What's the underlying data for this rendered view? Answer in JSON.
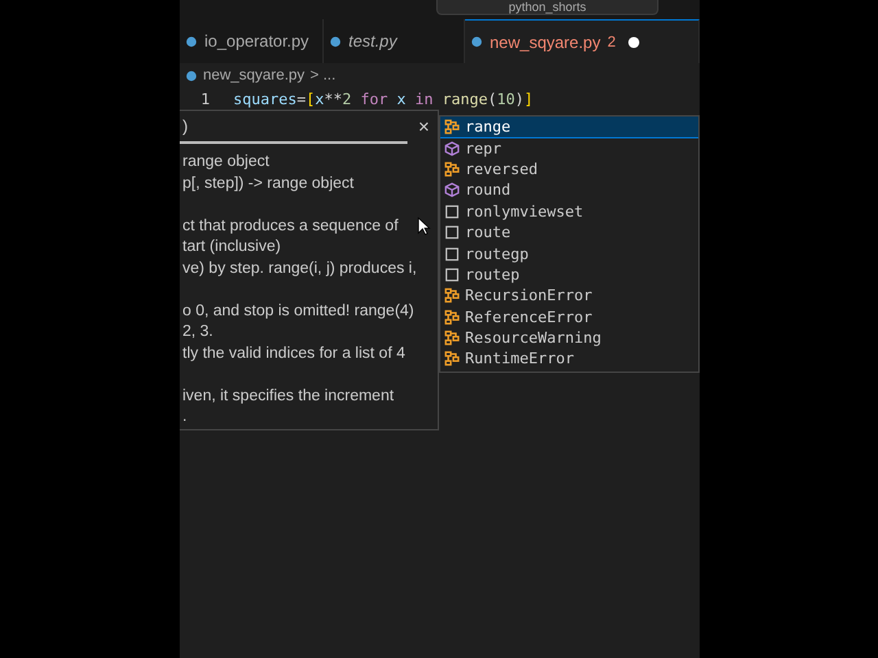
{
  "search": {
    "text": "python_shorts"
  },
  "tabs": [
    {
      "label": "io_operator.py",
      "italic": false,
      "selected": false,
      "dirty": false
    },
    {
      "label": "test.py",
      "italic": true,
      "selected": false,
      "dirty": false
    },
    {
      "label": "new_sqyare.py",
      "italic": false,
      "selected": true,
      "dirty": true,
      "problems": "2"
    }
  ],
  "breadcrumb": {
    "file": "new_sqyare.py",
    "rest": "> ..."
  },
  "editor": {
    "line_number": "1",
    "tokens": [
      {
        "text": "squares",
        "kind": "var"
      },
      {
        "text": "=",
        "kind": "op"
      },
      {
        "text": "[",
        "kind": "bracket"
      },
      {
        "text": "x",
        "kind": "var"
      },
      {
        "text": "**",
        "kind": "op"
      },
      {
        "text": "2",
        "kind": "num"
      },
      {
        "text": " for ",
        "kind": "kw"
      },
      {
        "text": "x",
        "kind": "var"
      },
      {
        "text": " in ",
        "kind": "kw"
      },
      {
        "text": "range",
        "kind": "fn"
      },
      {
        "text": "(",
        "kind": "op"
      },
      {
        "text": "10",
        "kind": "num"
      },
      {
        "text": ")",
        "kind": "op"
      },
      {
        "text": "]",
        "kind": "bracket"
      }
    ]
  },
  "hover": {
    "signature": ")",
    "close": "×",
    "paragraphs": [
      [
        "range object",
        "p[, step]) -> range object"
      ],
      [
        "ct that produces a sequence of",
        "tart (inclusive)",
        "ve) by step. range(i, j) produces i,"
      ],
      [
        "o 0, and stop is omitted! range(4)",
        "2, 3.",
        "tly the valid indices for a list of 4"
      ],
      [
        "iven, it specifies the increment",
        "."
      ]
    ]
  },
  "suggestions": [
    {
      "label": "range",
      "kind": "class",
      "selected": true
    },
    {
      "label": "repr",
      "kind": "method",
      "selected": false
    },
    {
      "label": "reversed",
      "kind": "class",
      "selected": false
    },
    {
      "label": "round",
      "kind": "method",
      "selected": false
    },
    {
      "label": "ronlymviewset",
      "kind": "text",
      "selected": false
    },
    {
      "label": "route",
      "kind": "text",
      "selected": false
    },
    {
      "label": "routegp",
      "kind": "text",
      "selected": false
    },
    {
      "label": "routep",
      "kind": "text",
      "selected": false
    },
    {
      "label": "RecursionError",
      "kind": "class",
      "selected": false
    },
    {
      "label": "ReferenceError",
      "kind": "class",
      "selected": false
    },
    {
      "label": "ResourceWarning",
      "kind": "class",
      "selected": false
    },
    {
      "label": "RuntimeError",
      "kind": "class",
      "selected": false
    }
  ]
}
